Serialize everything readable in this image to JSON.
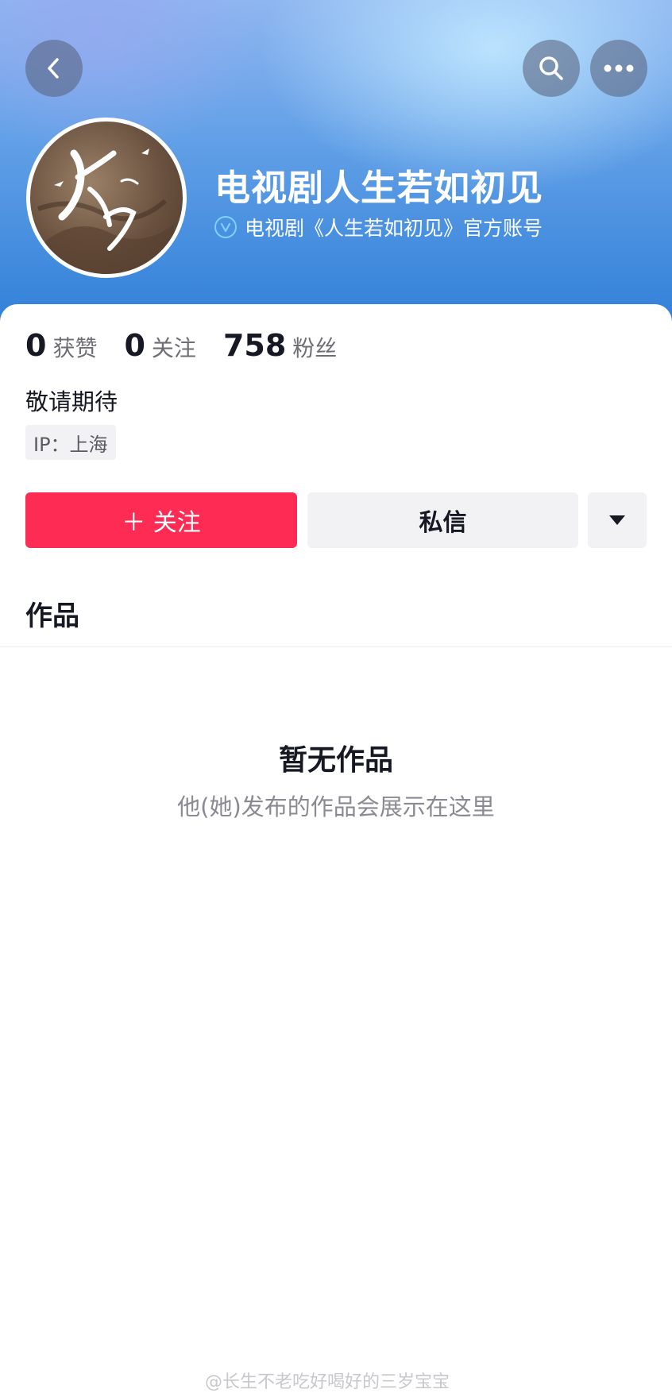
{
  "header": {
    "back_icon": "chevron-left-icon",
    "search_icon": "search-icon",
    "more_icon": "more-horizontal-icon",
    "name": "电视剧人生若如初见",
    "verify_text": "电视剧《人生若如初见》官方账号",
    "verify_icon": "verified-badge-icon"
  },
  "stats": {
    "likes_count": "0",
    "likes_label": "获赞",
    "following_count": "0",
    "following_label": "关注",
    "fans_count": "758",
    "fans_label": "粉丝"
  },
  "bio": "敬请期待",
  "ip_tag": "IP：上海",
  "actions": {
    "follow_label": "＋ 关注",
    "message_label": "私信",
    "dropdown_icon": "triangle-down-icon"
  },
  "tabs": {
    "works_label": "作品"
  },
  "empty_state": {
    "title": "暂无作品",
    "description": "他(她)发布的作品会展示在这里"
  },
  "watermark": "@长生不老吃好喝好的三岁宝宝",
  "colors": {
    "accent": "#fe2c55",
    "header_blue": "#2f7fd8",
    "button_gray": "#f2f2f4"
  }
}
